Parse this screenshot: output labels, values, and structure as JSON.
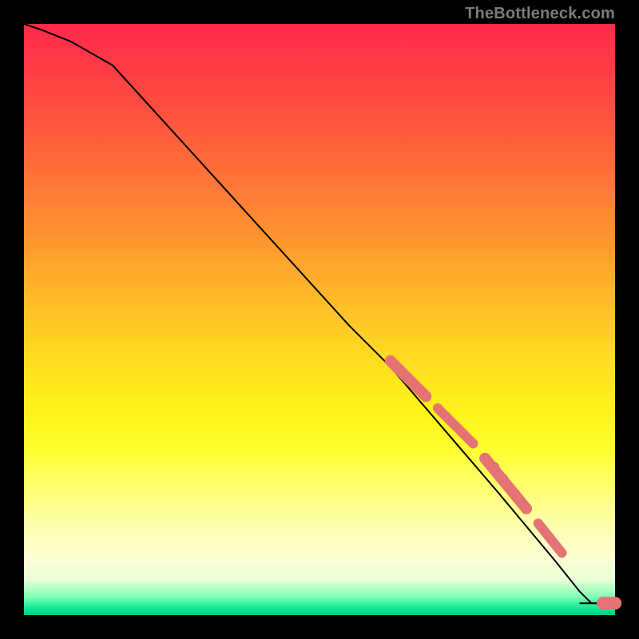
{
  "attribution": "TheBottleneck.com",
  "colors": {
    "dot": "#e57373",
    "curve": "#000000"
  },
  "chart_data": {
    "type": "line",
    "title": "",
    "xlabel": "",
    "ylabel": "",
    "xlim": [
      0,
      100
    ],
    "ylim": [
      0,
      100
    ],
    "grid": false,
    "series": [
      {
        "name": "curve",
        "x": [
          0,
          3,
          8,
          15,
          25,
          35,
          45,
          55,
          62,
          68,
          74,
          80,
          85,
          90,
          94,
          96,
          100
        ],
        "y": [
          100,
          99,
          97,
          93,
          82,
          71,
          60,
          49,
          42,
          35,
          28,
          21,
          15,
          9,
          4,
          2,
          2
        ]
      }
    ],
    "scatter_points": {
      "name": "highlighted-dots",
      "x": [
        62,
        63.5,
        65,
        66.5,
        68,
        70,
        71.5,
        73,
        74.5,
        76,
        78,
        79.5,
        81,
        83,
        85,
        87,
        89,
        91,
        98,
        100
      ],
      "y": [
        43,
        41.5,
        40,
        38.5,
        37,
        35,
        33.5,
        32,
        30.5,
        29,
        26.5,
        25,
        23,
        20.5,
        18,
        15.5,
        13,
        10.5,
        2,
        2
      ],
      "r": [
        7,
        7,
        7,
        7,
        7,
        6,
        6,
        6,
        6,
        6,
        7,
        7,
        7,
        7,
        7,
        6,
        6,
        6,
        8,
        8
      ]
    }
  }
}
